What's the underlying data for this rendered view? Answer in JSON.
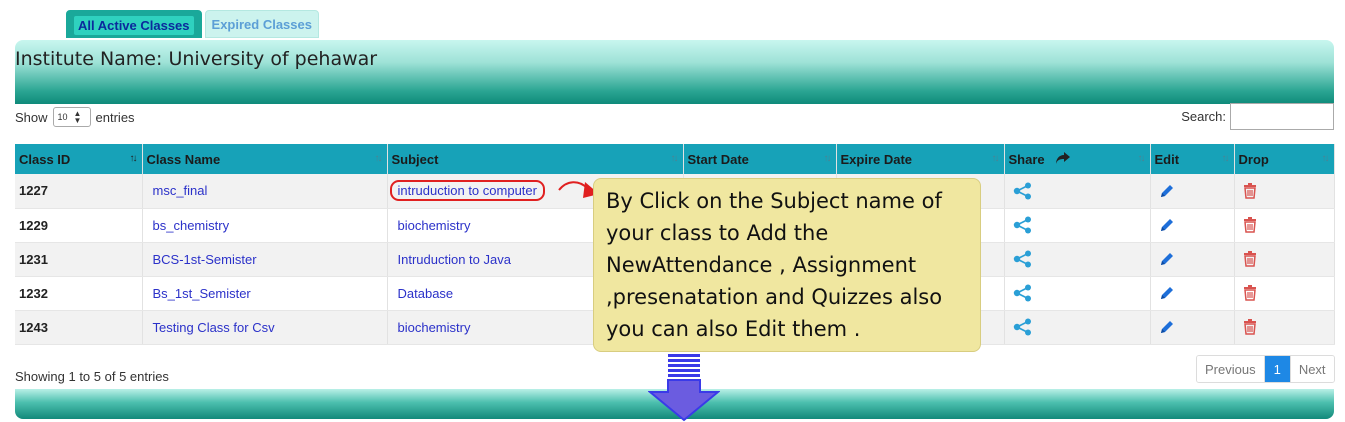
{
  "tabs": [
    {
      "label": "All Active Classes",
      "active": true
    },
    {
      "label": "Expired Classes",
      "active": false
    }
  ],
  "header": {
    "title": "Institute Name: University of pehawar"
  },
  "length_control": {
    "prefix": "Show",
    "value": "10",
    "suffix": "entries"
  },
  "search": {
    "label": "Search:",
    "value": ""
  },
  "table": {
    "columns": [
      "Class ID",
      "Class Name",
      "Subject",
      "Start Date",
      "Expire Date",
      "Share",
      "Edit",
      "Drop"
    ],
    "rows": [
      {
        "id": "1227",
        "name": "msc_final",
        "subject": "intruduction to computer"
      },
      {
        "id": "1229",
        "name": "bs_chemistry",
        "subject": "biochemistry"
      },
      {
        "id": "1231",
        "name": "BCS-1st-Semister",
        "subject": "Intruduction to Java"
      },
      {
        "id": "1232",
        "name": "Bs_1st_Semister",
        "subject": "Database"
      },
      {
        "id": "1243",
        "name": "Testing Class for Csv",
        "subject": "biochemistry"
      }
    ]
  },
  "callout": {
    "text": "By Click on the Subject name of your class to Add the NewAttendance , Assignment ,presenatation and Quizzes also you can also Edit them ."
  },
  "footer": {
    "info": "Showing 1 to 5 of 5 entries"
  },
  "pagination": {
    "previous": "Previous",
    "current": "1",
    "next": "Next"
  },
  "colors": {
    "accent": "#17a2b8",
    "link": "#2b31c9",
    "teal_dark": "#0f8a7a",
    "callout_bg": "#f0e7a0",
    "drop": "#d9534f",
    "edit": "#1e6fd9",
    "share": "#2a9fd6"
  }
}
